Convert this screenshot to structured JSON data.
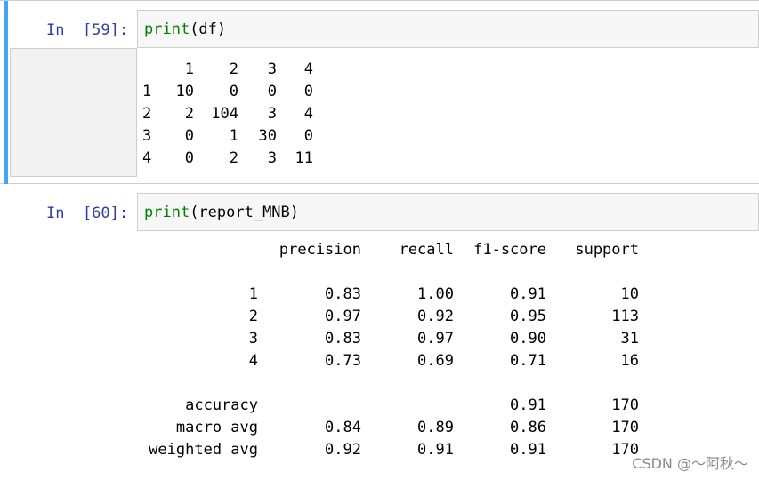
{
  "cells": [
    {
      "prompt": "In  [59]:",
      "code": {
        "func": "print",
        "args": "(df)"
      },
      "output": {
        "header": [
          "",
          "1",
          "2",
          "3",
          "4"
        ],
        "rows": [
          [
            "1",
            "10",
            "0",
            "0",
            "0"
          ],
          [
            "2",
            "2",
            "104",
            "3",
            "4"
          ],
          [
            "3",
            "0",
            "1",
            "30",
            "0"
          ],
          [
            "4",
            "0",
            "2",
            "3",
            "11"
          ]
        ]
      }
    },
    {
      "prompt": "In  [60]:",
      "code": {
        "func": "print",
        "args": "(report_MNB)"
      },
      "output": {
        "header": [
          "",
          "precision",
          "recall",
          "f1-score",
          "support"
        ],
        "rows": [
          [
            "1",
            "0.83",
            "1.00",
            "0.91",
            "10"
          ],
          [
            "2",
            "0.97",
            "0.92",
            "0.95",
            "113"
          ],
          [
            "3",
            "0.83",
            "0.97",
            "0.90",
            "31"
          ],
          [
            "4",
            "0.73",
            "0.69",
            "0.71",
            "16"
          ],
          [
            "",
            "",
            "",
            "",
            ""
          ],
          [
            "accuracy",
            "",
            "",
            "0.91",
            "170"
          ],
          [
            "macro avg",
            "0.84",
            "0.89",
            "0.86",
            "170"
          ],
          [
            "weighted avg",
            "0.92",
            "0.91",
            "0.91",
            "170"
          ]
        ]
      }
    }
  ],
  "watermark": "CSDN @～阿秋～",
  "colors": {
    "selection_bar": "#42a5f5",
    "prompt": "#303f9f",
    "builtin": "#008000",
    "input_bg": "#f7f7f7"
  }
}
